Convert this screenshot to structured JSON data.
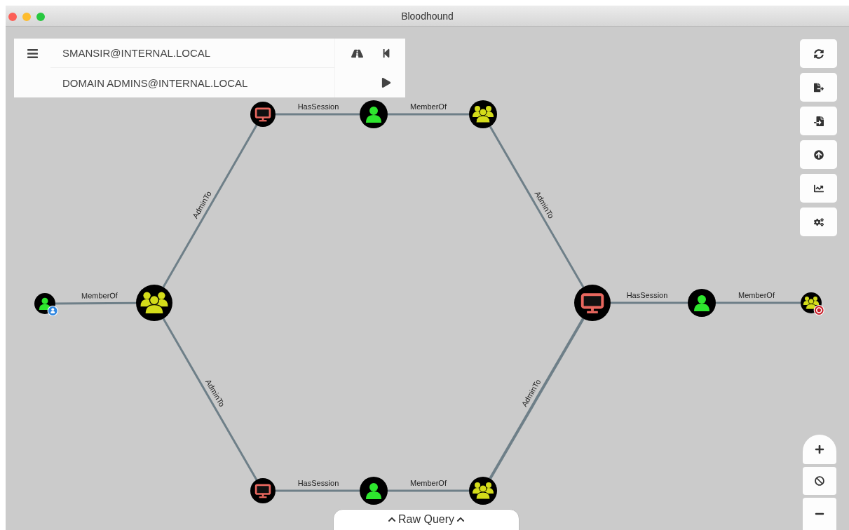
{
  "window": {
    "title": "Bloodhound"
  },
  "search": {
    "start_node": "SMANSIR@INTERNAL.LOCAL",
    "target_node": "DOMAIN ADMINS@INTERNAL.LOCAL"
  },
  "graph": {
    "nodes": [
      {
        "kind": "computer",
        "owned": false,
        "high_value": false
      },
      {
        "kind": "user",
        "owned": false,
        "high_value": false
      },
      {
        "kind": "group",
        "owned": false,
        "high_value": false
      },
      {
        "kind": "user",
        "owned": true,
        "high_value": false
      },
      {
        "kind": "group",
        "owned": false,
        "high_value": false
      },
      {
        "kind": "computer",
        "owned": false,
        "high_value": false
      },
      {
        "kind": "user",
        "owned": false,
        "high_value": false
      },
      {
        "kind": "group",
        "owned": false,
        "high_value": true
      },
      {
        "kind": "computer",
        "owned": false,
        "high_value": false
      },
      {
        "kind": "user",
        "owned": false,
        "high_value": false
      },
      {
        "kind": "group",
        "owned": false,
        "high_value": false
      }
    ],
    "edges": [
      {
        "label": "HasSession"
      },
      {
        "label": "MemberOf"
      },
      {
        "label": "AdminTo"
      },
      {
        "label": "AdminTo"
      },
      {
        "label": "MemberOf"
      },
      {
        "label": "HasSession"
      },
      {
        "label": "MemberOf"
      },
      {
        "label": "AdminTo"
      },
      {
        "label": "AdminTo"
      },
      {
        "label": "HasSession"
      },
      {
        "label": "MemberOf"
      }
    ]
  },
  "raw_query": {
    "label": "Raw Query"
  }
}
